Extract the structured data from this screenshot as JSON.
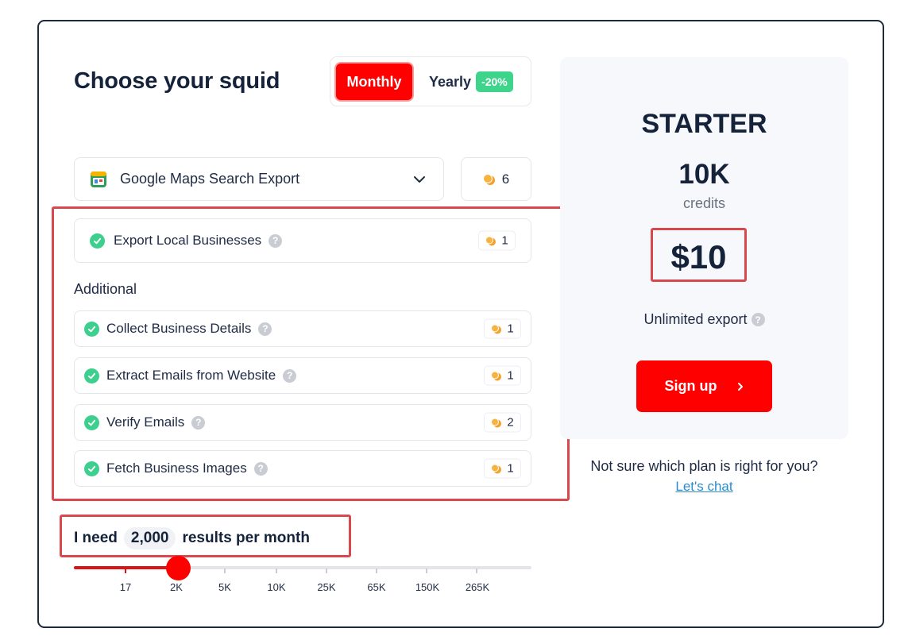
{
  "header": {
    "title": "Choose your squid"
  },
  "billing_toggle": {
    "monthly_label": "Monthly",
    "yearly_label": "Yearly",
    "yearly_discount": "-20%",
    "selected": "Monthly"
  },
  "service_select": {
    "selected": "Google Maps Search Export",
    "credits": "6"
  },
  "main_feature": {
    "label": "Export Local Businesses",
    "credits": "1"
  },
  "additional": {
    "heading": "Additional",
    "items": [
      {
        "label": "Collect Business Details",
        "credits": "1"
      },
      {
        "label": "Extract Emails from Website",
        "credits": "1"
      },
      {
        "label": "Verify Emails",
        "credits": "2"
      },
      {
        "label": "Fetch Business Images",
        "credits": "1"
      }
    ]
  },
  "results": {
    "prefix": "I need",
    "value": "2,000",
    "suffix": "results per month"
  },
  "slider": {
    "ticks": [
      "17",
      "2K",
      "5K",
      "10K",
      "25K",
      "65K",
      "150K",
      "265K"
    ],
    "selected_index": 1
  },
  "plan": {
    "name": "STARTER",
    "credits_amount": "10K",
    "credits_unit": "credits",
    "price": "$10",
    "feature": "Unlimited export",
    "signup_label": "Sign up"
  },
  "footer": {
    "help_text": "Not sure which plan is right for you?",
    "chat_link": "Let's chat"
  },
  "help_glyph": "?",
  "colors": {
    "accent_red": "#ff0000",
    "check_green": "#3ccf8e",
    "discount_green": "#3ed48b",
    "coin_orange": "#f4a02a",
    "highlight_outline": "#d9484c",
    "link_blue": "#2a8ccf"
  }
}
